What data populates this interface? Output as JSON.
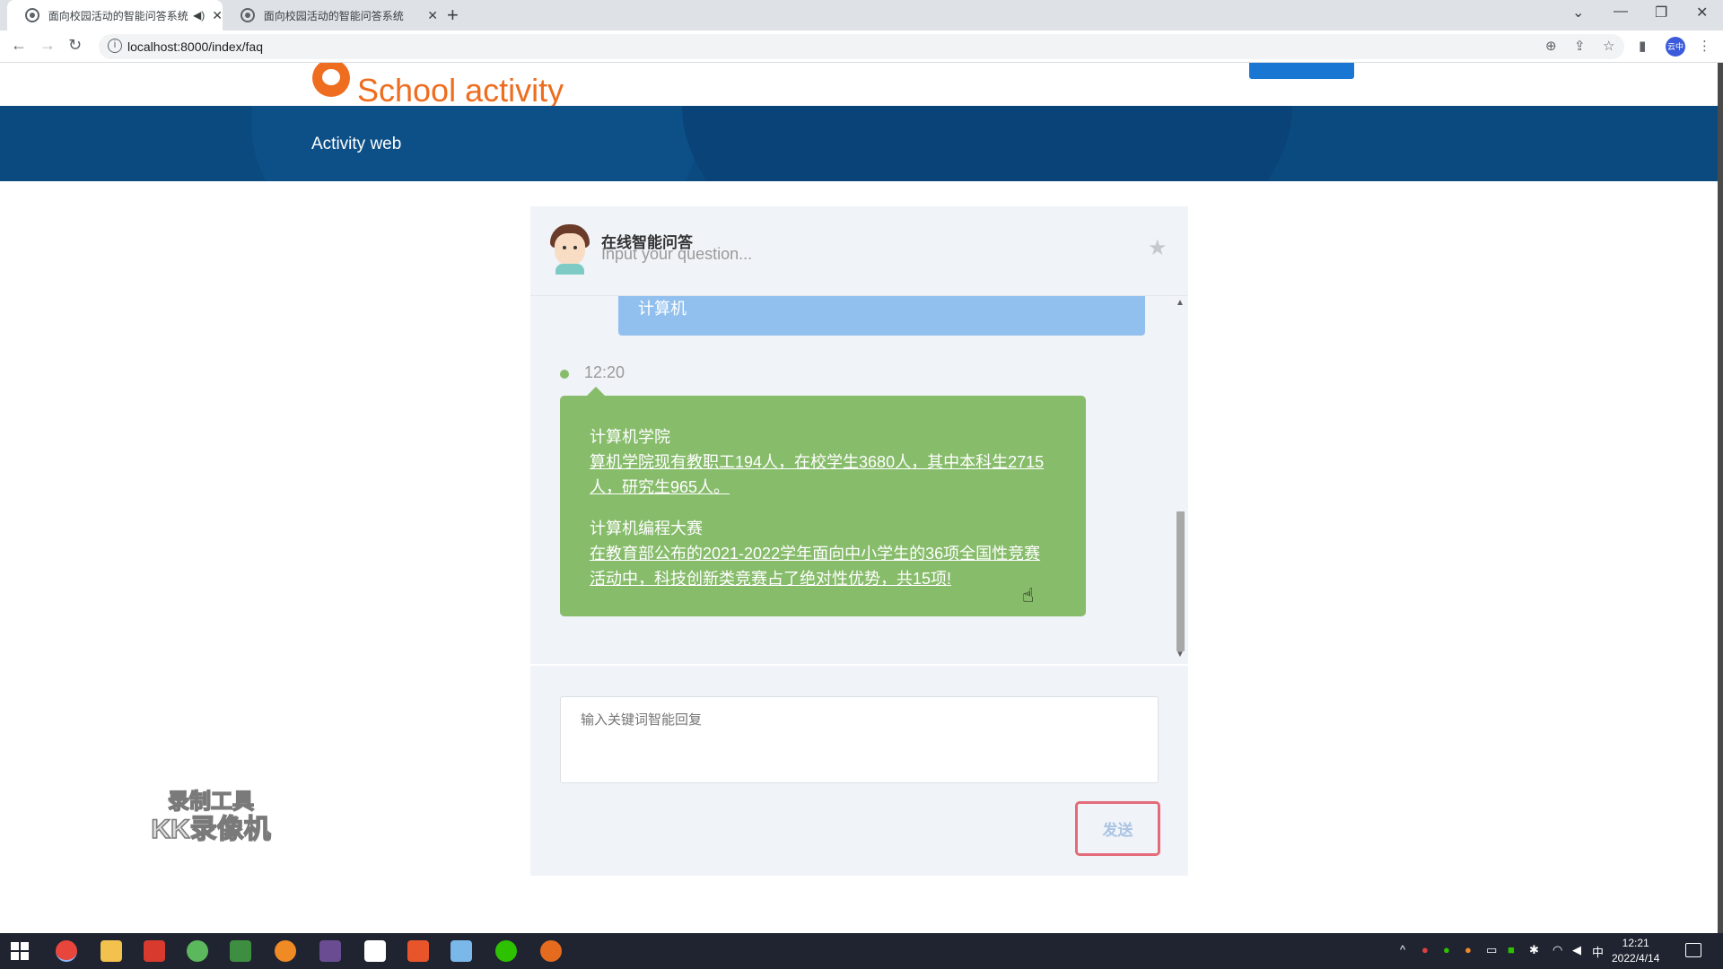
{
  "browser": {
    "tabs": [
      {
        "title": "面向校园活动的智能问答系统",
        "active": true
      },
      {
        "title": "面向校园活动的智能问答系统",
        "active": false
      }
    ],
    "url": "localhost:8000/index/faq",
    "profile_label": "云中"
  },
  "site": {
    "logo_text": "School activity",
    "banner_title": "Activity web"
  },
  "chat": {
    "title": "在线智能问答",
    "subtitle": "Input your question...",
    "user_message": "计算机",
    "reply_time": "12:20",
    "answers": [
      {
        "question": "计算机学院",
        "answer": "算机学院现有教职工194人，在校学生3680人，其中本科生2715人，研究生965人。"
      },
      {
        "question": "计算机编程大赛",
        "answer": "在教育部公布的2021-2022学年面向中小学生的36项全国性竞赛活动中，科技创新类竞赛占了绝对性优势，共15项!"
      }
    ],
    "input_placeholder": "输入关键词智能回复",
    "send_label": "发送"
  },
  "watermark": {
    "line1": "录制工具",
    "line2": "KK录像机"
  },
  "taskbar": {
    "time": "12:21",
    "date": "2022/4/14",
    "ime": "中"
  },
  "colors": {
    "brand_orange": "#ee6d1f",
    "banner_blue": "#0b4a7f",
    "user_bubble": "#92c0ee",
    "bot_bubble": "#87bc6b",
    "send_border": "#e36b7a"
  }
}
